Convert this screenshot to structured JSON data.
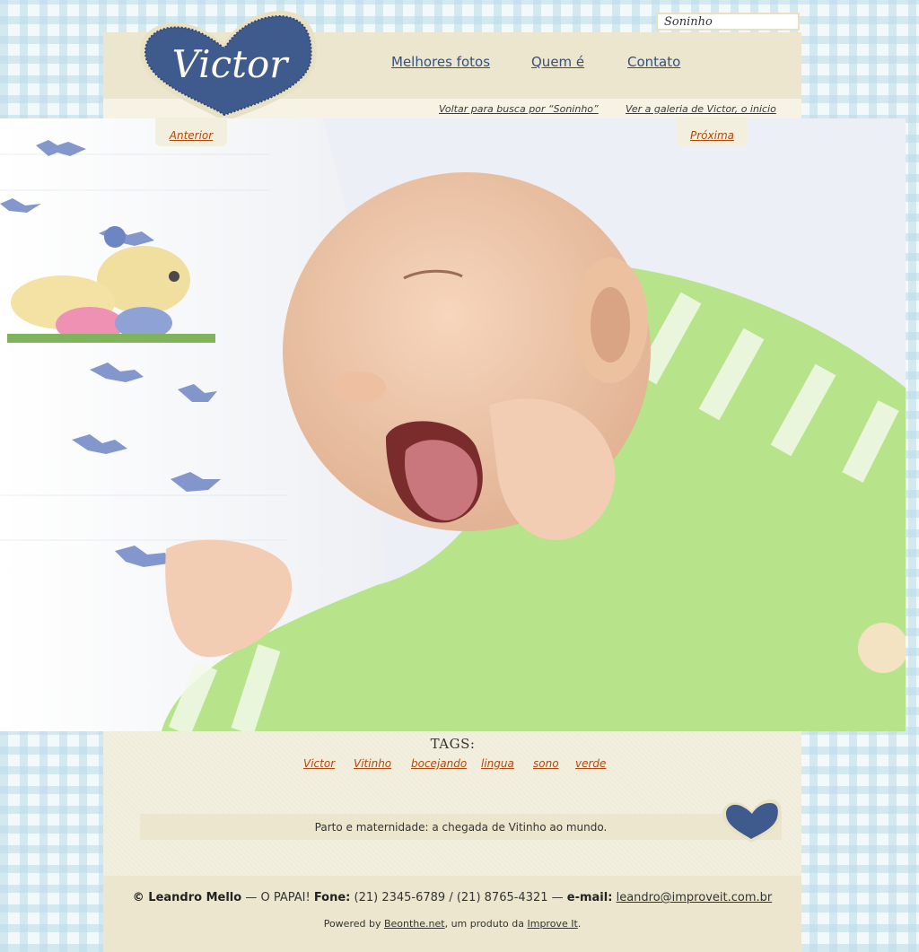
{
  "search": {
    "value": "Soninho"
  },
  "logo": {
    "text": "Victor"
  },
  "nav": [
    {
      "label": "Melhores fotos"
    },
    {
      "label": "Quem é"
    },
    {
      "label": "Contato"
    }
  ],
  "subnav": {
    "back_label": "Voltar para busca por “Soninho”",
    "gallery_label": "Ver a galeria de Victor, o inicio"
  },
  "pager": {
    "prev_label": "Anterior",
    "next_label": "Próxima"
  },
  "photo": {
    "icon": "baby-yawning-photo"
  },
  "tags": {
    "title": "TAGS:",
    "items": [
      "Victor",
      "Vitinho",
      "bocejando",
      "lingua",
      "sono",
      "verde"
    ]
  },
  "caption": {
    "text": "Parto e maternidade: a chegada de Vitinho ao mundo."
  },
  "footer": {
    "author": "© Leandro Mello",
    "dash1": " — O PAPAI! ",
    "phone_label": "Fone:",
    "phones": " (21) 2345-6789 / (21) 8765-4321 — ",
    "email_label": "e-mail:",
    "email": "leandro@improveit.com.br",
    "powered_prefix": "Powered by ",
    "powered_link": "Beonthe.net",
    "powered_middle": ", um produto da ",
    "company_link": "Improve It",
    "powered_suffix": "."
  },
  "colors": {
    "heart": "#3f5a8c",
    "link": "#b0480e",
    "nav": "#35507c",
    "cream": "#f3efdf"
  }
}
